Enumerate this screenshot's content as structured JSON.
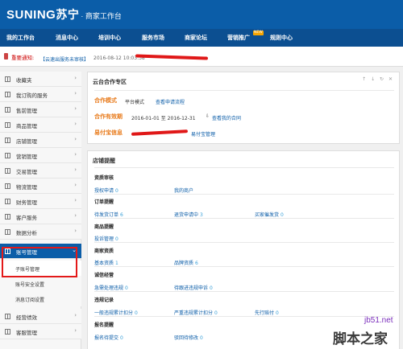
{
  "header": {
    "logo_en": "SUNING",
    "logo_cn": "苏宁",
    "logo_sub": "· 商家工作台"
  },
  "nav": [
    "我的工作台",
    "消息中心",
    "培训中心",
    "服务市场",
    "商家论坛",
    "营销推广",
    "规则中心"
  ],
  "nav_badge": "NEW",
  "notice": {
    "label": "重要通知:",
    "text": "【云速出服务未审核】",
    "date": "2016-08-12 10:03:38"
  },
  "sidebar": {
    "items_top": [
      "收藏夹",
      "我订购的服务",
      "售前管理",
      "商品管理",
      "店铺管理",
      "营销管理",
      "交易管理",
      "物流管理",
      "财务管理",
      "客户服务",
      "数据分析",
      "账号管理"
    ],
    "sub_items": [
      "子账号管理",
      "账号安全设置",
      "消息订阅设置"
    ],
    "items_bottom": [
      "经营绩效",
      "客服管理"
    ]
  },
  "coop": {
    "title": "云台合作专区",
    "tools": "↑ ↓ ↻ ✕",
    "mode_label": "合作模式",
    "mode_value": "平台模式",
    "mode_link": "查看申请流程",
    "period_label": "合作有效期",
    "period_value": "2016-01-01 至 2016-12-31",
    "period_link": "查看我的合同",
    "pay_label": "易付宝信息",
    "pay_link": "易付宝管理"
  },
  "store": {
    "title": "店铺提醒",
    "sections": [
      {
        "title": "资质审核",
        "entries": [
          {
            "label": "授权申请",
            "count": "0"
          },
          {
            "label": "我的商户",
            "count": ""
          }
        ]
      },
      {
        "title": "订单提醒",
        "entries": [
          {
            "label": "待发货订单",
            "count": "6"
          },
          {
            "label": "退货申请中",
            "count": "3"
          },
          {
            "label": "买家催发货",
            "count": "0"
          }
        ]
      },
      {
        "title": "商品提醒",
        "entries": [
          {
            "label": "投诉管理",
            "count": "0"
          }
        ]
      },
      {
        "title": "商家资质",
        "entries": [
          {
            "label": "基本资质",
            "count": "1"
          },
          {
            "label": "品牌资质",
            "count": "6"
          }
        ]
      },
      {
        "title": "诚信经营",
        "entries": [
          {
            "label": "急需处理违规",
            "count": "0"
          },
          {
            "label": "待跟进违规申诉",
            "count": "0"
          }
        ]
      },
      {
        "title": "违规记录",
        "entries": [
          {
            "label": "一般违规累计扣分",
            "count": "0"
          },
          {
            "label": "严重违规累计扣分",
            "count": "0"
          },
          {
            "label": "先行赔付",
            "count": "0"
          }
        ]
      },
      {
        "title": "报名提醒",
        "entries": [
          {
            "label": "报名待提交",
            "count": "0"
          },
          {
            "label": "驳回待修改",
            "count": "0"
          }
        ]
      }
    ]
  },
  "watermark": {
    "site": "jb51.net",
    "brand": "脚本之家"
  },
  "colors": {
    "header": "#0b5da8",
    "nav": "#0c4f91",
    "accent_orange": "#e87a1a",
    "link": "#0b5da8",
    "highlight_box": "#e31919"
  }
}
